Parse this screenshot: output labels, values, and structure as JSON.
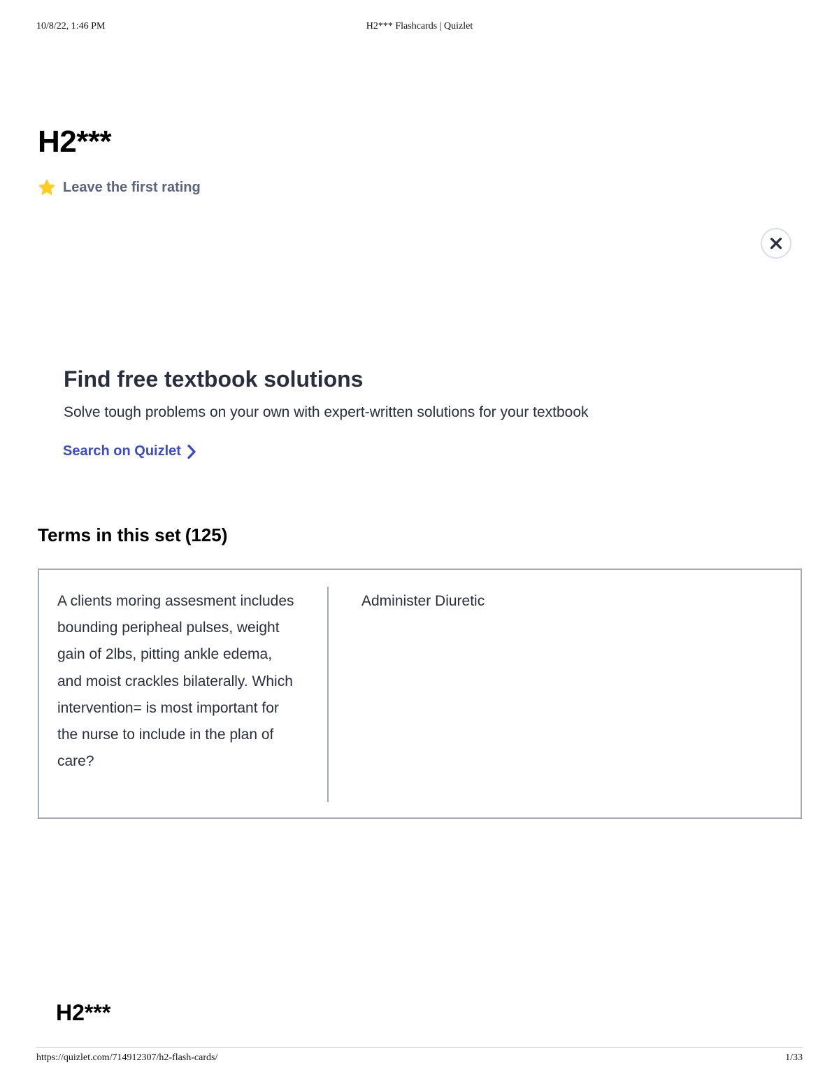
{
  "print_header": {
    "date": "10/8/22, 1:46 PM",
    "title": "H2*** Flashcards | Quizlet"
  },
  "set": {
    "title": "H2***",
    "rating_label": "Leave the first rating"
  },
  "icons": {
    "rating": "star-icon",
    "close": "close-icon",
    "link": "chevron-right-icon"
  },
  "colors": {
    "star": "#ffcd1f",
    "link": "#3c4bc8",
    "muted_text": "#586380",
    "card_border": "#a3a9bb"
  },
  "promo": {
    "title": "Find free textbook solutions",
    "subtitle": "Solve tough problems on your own with expert-written solutions for your textbook",
    "link_label": "Search on Quizlet"
  },
  "terms_section": {
    "heading": "Terms in this set",
    "count": "(125)",
    "cards": [
      {
        "term": "A clients moring assesment includes bounding peripheal pulses, weight gain of 2lbs, pitting ankle edema, and moist crackles bilaterally. Which intervention= is most important for the nurse to include in the plan of care?",
        "definition": "Administer Diuretic"
      }
    ]
  },
  "bottom_title": "H2***",
  "print_footer": {
    "url": "https://quizlet.com/714912307/h2-flash-cards/",
    "page": "1/33"
  }
}
